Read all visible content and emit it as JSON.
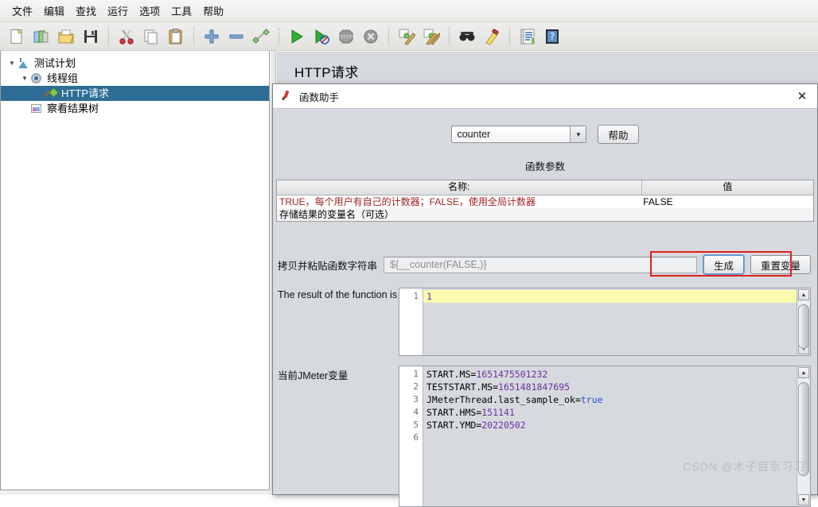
{
  "menubar": {
    "items": [
      {
        "label": "文件",
        "name": "menu-file"
      },
      {
        "label": "编辑",
        "name": "menu-edit"
      },
      {
        "label": "查找",
        "name": "menu-search"
      },
      {
        "label": "运行",
        "name": "menu-run"
      },
      {
        "label": "选项",
        "name": "menu-options"
      },
      {
        "label": "工具",
        "name": "menu-tools"
      },
      {
        "label": "帮助",
        "name": "menu-help"
      }
    ]
  },
  "toolbar": {
    "icons": [
      "new-icon",
      "templates-icon",
      "open-icon",
      "save-icon",
      "cut-icon",
      "copy-icon",
      "paste-icon",
      "add-icon",
      "remove-icon",
      "toggle-icon",
      "start-icon",
      "start-no-pauses-icon",
      "stop-icon",
      "shutdown-icon",
      "clear-icon",
      "clear-all-icon",
      "search-icon",
      "search-reset-icon",
      "function-helper-icon",
      "help-icon"
    ]
  },
  "tree": {
    "nodes": [
      {
        "label": "测试计划",
        "icon": "test-plan-icon",
        "level": 1,
        "twisty": "▼",
        "selected": false,
        "name": "tree-node-test-plan"
      },
      {
        "label": "线程组",
        "icon": "thread-group-icon",
        "level": 2,
        "twisty": "▼",
        "selected": false,
        "name": "tree-node-thread-group"
      },
      {
        "label": "HTTP请求",
        "icon": "http-request-icon",
        "level": 3,
        "twisty": "",
        "selected": true,
        "name": "tree-node-http-request"
      },
      {
        "label": "察看结果树",
        "icon": "view-results-tree-icon",
        "level": 2,
        "twisty": "",
        "selected": false,
        "name": "tree-node-view-results-tree"
      }
    ]
  },
  "right_pane": {
    "title": "HTTP请求"
  },
  "dialog": {
    "title": "函数助手",
    "close_label": "✕",
    "function_select": {
      "value": "counter",
      "arrow": "▼"
    },
    "help_button": "帮助",
    "params_title": "函数参数",
    "params_table": {
      "headers": [
        "名称:",
        "值"
      ],
      "rows": [
        {
          "name": "TRUE，每个用户有自己的计数器；FALSE，使用全局计数器",
          "value": "FALSE"
        },
        {
          "name": "存储结果的变量名（可选）",
          "value": ""
        }
      ]
    },
    "copy_paste": {
      "label": "拷贝并粘贴函数字符串",
      "value": "${__counter(FALSE,)}"
    },
    "generate_button": "生成",
    "reset_button": "重置变量",
    "result": {
      "label": "The result of the function is",
      "lines": [
        {
          "no": "1",
          "text": "1",
          "highlight": true
        }
      ]
    },
    "variables": {
      "label": "当前JMeter变量",
      "lines": [
        {
          "no": "1",
          "key": "START.MS",
          "value": "1651475501232",
          "kind": "num",
          "highlight": false
        },
        {
          "no": "2",
          "key": "TESTSTART.MS",
          "value": "1651481847695",
          "kind": "num",
          "highlight": false
        },
        {
          "no": "3",
          "key": "JMeterThread.last_sample_ok",
          "value": "true",
          "kind": "bool",
          "highlight": false
        },
        {
          "no": "4",
          "key": "START.HMS",
          "value": "151141",
          "kind": "num",
          "highlight": false
        },
        {
          "no": "5",
          "key": "START.YMD",
          "value": "20220502",
          "kind": "num",
          "highlight": false
        },
        {
          "no": "6",
          "key": "",
          "value": "",
          "kind": "none",
          "highlight": true
        }
      ]
    },
    "scroll_up": "▲",
    "scroll_down": "▼"
  },
  "watermark": "CSDN @木子目京习习",
  "colors": {
    "selection": "#2e6d96",
    "highlight": "#fbfbb0",
    "red_box": "#e02020",
    "param_name_text": "#a21f1f",
    "number_token": "#6b2fa0",
    "boolean_token": "#2a4fd6"
  }
}
